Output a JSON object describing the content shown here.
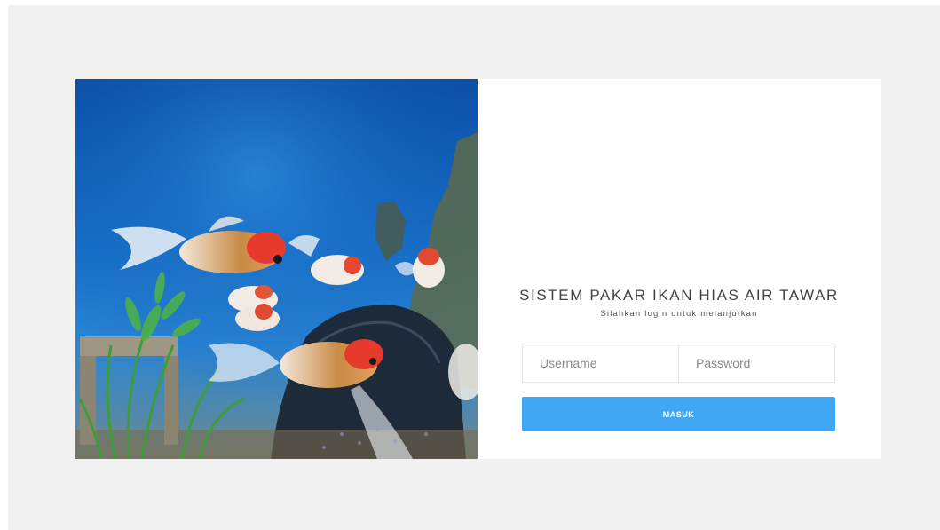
{
  "brand": {
    "title": "SISTEM PAKAR IKAN HIAS AIR TAWAR",
    "subtitle": "Silahkan login untuk melanjutkan"
  },
  "hero": {
    "image_subject": "goldfish-aquarium-photo"
  },
  "form": {
    "username_placeholder": "Username",
    "password_placeholder": "Password",
    "submit_label": "MASUK"
  },
  "colors": {
    "page_background": "#f1f1f1",
    "card_background": "#ffffff",
    "button": "#3fa7f5",
    "title_text": "#444444"
  }
}
